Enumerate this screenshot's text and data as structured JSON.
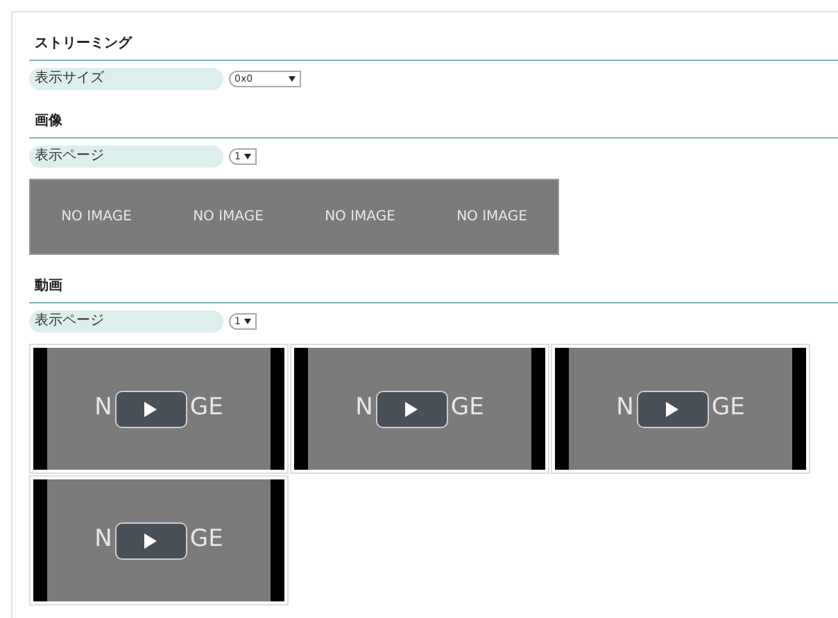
{
  "sections": [
    {
      "title": "ストリーミング",
      "kind": "settings",
      "field": {
        "label": "表示サイズ",
        "value": "0x0"
      }
    },
    {
      "title": "画像",
      "kind": "images",
      "field": {
        "label": "表示ページ",
        "value": "1"
      },
      "images": [
        {
          "text": "NO IMAGE"
        },
        {
          "text": "NO IMAGE"
        },
        {
          "text": "NO IMAGE"
        },
        {
          "text": "NO IMAGE"
        }
      ]
    },
    {
      "title": "動画",
      "kind": "videos",
      "field": {
        "label": "表示ページ",
        "value": "1"
      },
      "videos": [
        {
          "text_left": "N",
          "text_right": "GE"
        },
        {
          "text_left": "N",
          "text_right": "GE"
        },
        {
          "text_left": "N",
          "text_right": "GE"
        },
        {
          "text_left": "N",
          "text_right": "GE"
        }
      ]
    }
  ]
}
